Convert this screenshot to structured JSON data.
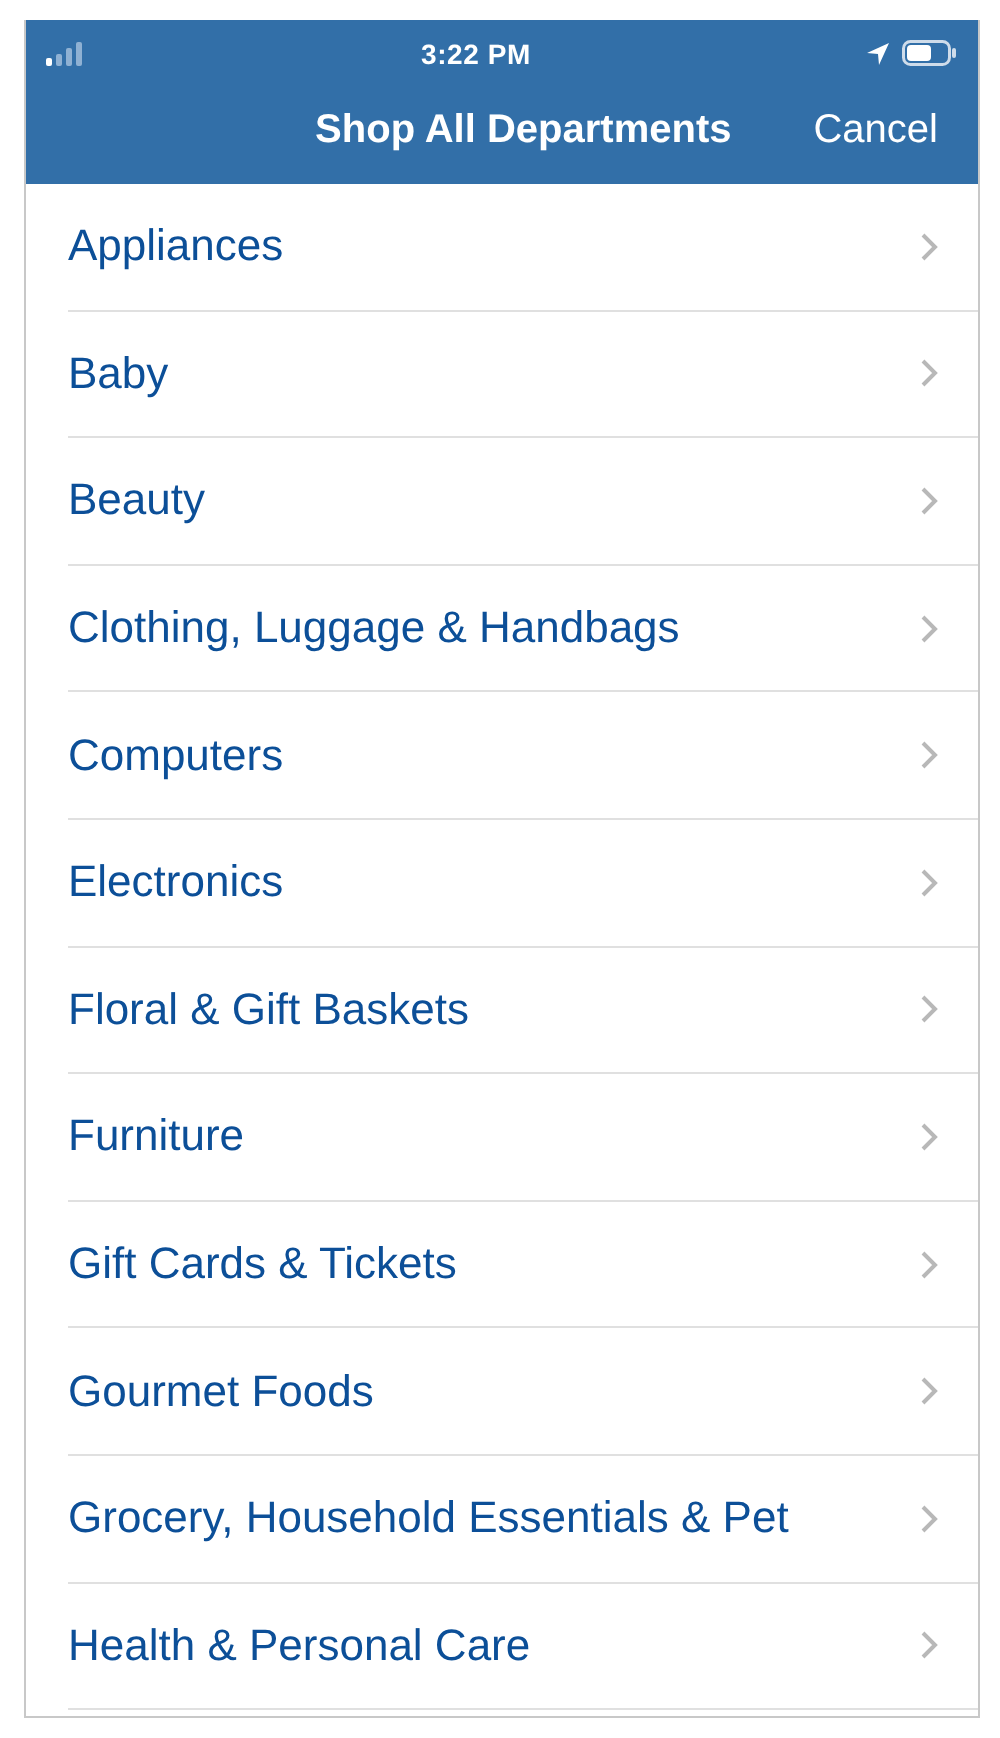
{
  "status_bar": {
    "time": "3:22 PM"
  },
  "nav_bar": {
    "title": "Shop All Departments",
    "cancel": "Cancel"
  },
  "departments": [
    {
      "label": "Appliances"
    },
    {
      "label": "Baby"
    },
    {
      "label": "Beauty"
    },
    {
      "label": "Clothing, Luggage & Handbags"
    },
    {
      "label": "Computers"
    },
    {
      "label": "Electronics"
    },
    {
      "label": "Floral & Gift Baskets"
    },
    {
      "label": "Furniture"
    },
    {
      "label": "Gift Cards & Tickets"
    },
    {
      "label": "Gourmet Foods"
    },
    {
      "label": "Grocery, Household Essentials & Pet"
    },
    {
      "label": "Health & Personal Care"
    }
  ]
}
